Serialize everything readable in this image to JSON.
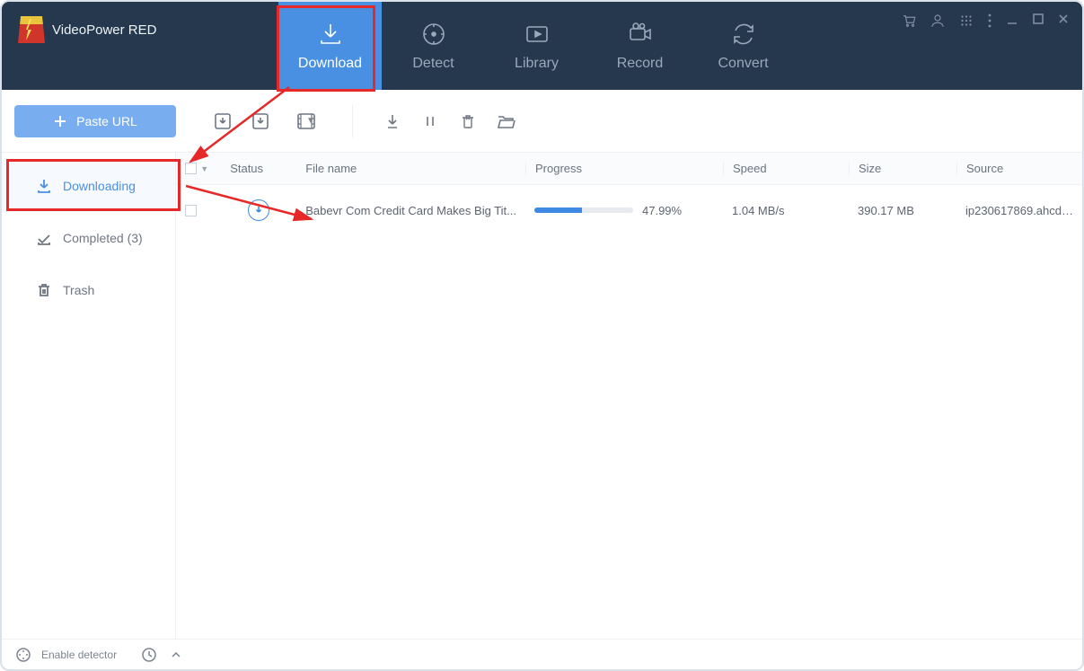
{
  "brand": "VideoPower RED",
  "nav": {
    "download": "Download",
    "detect": "Detect",
    "library": "Library",
    "record": "Record",
    "convert": "Convert"
  },
  "toolbar": {
    "paste_url": "Paste URL"
  },
  "sidebar": {
    "downloading": "Downloading",
    "completed": "Completed (3)",
    "trash": "Trash"
  },
  "columns": {
    "status": "Status",
    "filename": "File name",
    "progress": "Progress",
    "speed": "Speed",
    "size": "Size",
    "source": "Source"
  },
  "rows": [
    {
      "filename": "Babevr Com Credit Card Makes Big Tit...",
      "progress_pct": 47.99,
      "progress_label": "47.99%",
      "speed": "1.04 MB/s",
      "size": "390.17 MB",
      "source": "ip230617869.ahcdn...."
    }
  ],
  "footer": {
    "enable_detector": "Enable detector"
  }
}
